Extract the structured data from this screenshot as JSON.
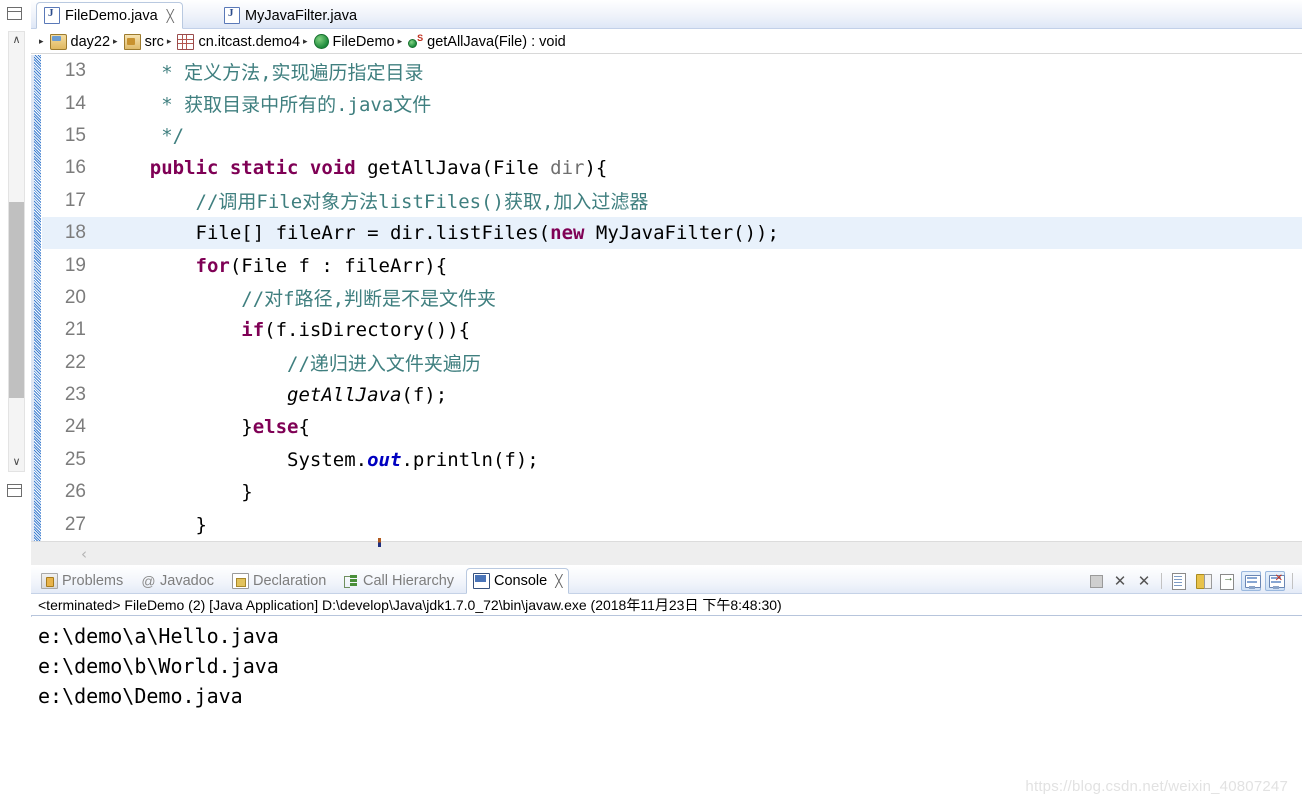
{
  "left_trim": {
    "restore_top_icon": "restore-view-icon",
    "restore_bottom_icon": "restore-view-icon",
    "scroll_up_glyph": "∧",
    "scroll_down_glyph": "∨"
  },
  "editor": {
    "tabs": [
      {
        "label": "FileDemo.java",
        "icon": "java-file-icon",
        "active": true,
        "close": "╳"
      },
      {
        "label": "MyJavaFilter.java",
        "icon": "java-file-icon",
        "active": false,
        "close": ""
      }
    ],
    "breadcrumb": {
      "arrow": "▸",
      "items": [
        {
          "label": "day22",
          "icon": "java-project-icon"
        },
        {
          "label": "src",
          "icon": "source-folder-icon"
        },
        {
          "label": "cn.itcast.demo4",
          "icon": "package-icon"
        },
        {
          "label": "FileDemo",
          "icon": "class-icon"
        },
        {
          "label": "getAllJava(File) : void",
          "icon": "static-method-icon"
        }
      ]
    },
    "hscroll_left_glyph": "‹",
    "lines": [
      {
        "no": "13",
        "highlight": false,
        "segments": [
          {
            "t": "     * ",
            "c": "jdoc"
          },
          {
            "t": "定义方法,实现遍历指定目录",
            "c": "jdoc"
          }
        ]
      },
      {
        "no": "14",
        "highlight": false,
        "segments": [
          {
            "t": "     * ",
            "c": "jdoc"
          },
          {
            "t": "获取目录中所有的.java文件",
            "c": "jdoc"
          }
        ]
      },
      {
        "no": "15",
        "highlight": false,
        "segments": [
          {
            "t": "     */",
            "c": "jdoc"
          }
        ]
      },
      {
        "no": "16",
        "highlight": false,
        "segments": [
          {
            "t": "    ",
            "c": "plain"
          },
          {
            "t": "public static void",
            "c": "kw"
          },
          {
            "t": " getAllJava(File ",
            "c": "plain"
          },
          {
            "t": "dir",
            "c": "param"
          },
          {
            "t": "){",
            "c": "plain"
          }
        ]
      },
      {
        "no": "17",
        "highlight": false,
        "segments": [
          {
            "t": "        ",
            "c": "plain"
          },
          {
            "t": "//调用File对象方法listFiles()获取,加入过滤器",
            "c": "cmt"
          }
        ]
      },
      {
        "no": "18",
        "highlight": true,
        "segments": [
          {
            "t": "        File[] fileArr = dir.listFiles(",
            "c": "plain"
          },
          {
            "t": "new",
            "c": "kw"
          },
          {
            "t": " MyJavaFilter());",
            "c": "plain"
          }
        ]
      },
      {
        "no": "19",
        "highlight": false,
        "segments": [
          {
            "t": "        ",
            "c": "plain"
          },
          {
            "t": "for",
            "c": "kw"
          },
          {
            "t": "(File f : fileArr){",
            "c": "plain"
          }
        ]
      },
      {
        "no": "20",
        "highlight": false,
        "segments": [
          {
            "t": "            ",
            "c": "plain"
          },
          {
            "t": "//对f路径,判断是不是文件夹",
            "c": "cmt"
          }
        ]
      },
      {
        "no": "21",
        "highlight": false,
        "segments": [
          {
            "t": "            ",
            "c": "plain"
          },
          {
            "t": "if",
            "c": "kw"
          },
          {
            "t": "(f.isDirectory()){",
            "c": "plain"
          }
        ]
      },
      {
        "no": "22",
        "highlight": false,
        "segments": [
          {
            "t": "                ",
            "c": "plain"
          },
          {
            "t": "//递归进入文件夹遍历",
            "c": "cmt"
          }
        ]
      },
      {
        "no": "23",
        "highlight": false,
        "segments": [
          {
            "t": "                ",
            "c": "plain"
          },
          {
            "t": "getAllJava",
            "c": "mth"
          },
          {
            "t": "(f);",
            "c": "plain"
          }
        ]
      },
      {
        "no": "24",
        "highlight": false,
        "segments": [
          {
            "t": "            }",
            "c": "plain"
          },
          {
            "t": "else",
            "c": "kw"
          },
          {
            "t": "{",
            "c": "plain"
          }
        ]
      },
      {
        "no": "25",
        "highlight": false,
        "segments": [
          {
            "t": "                System.",
            "c": "plain"
          },
          {
            "t": "out",
            "c": "static"
          },
          {
            "t": ".println(f);",
            "c": "plain"
          }
        ]
      },
      {
        "no": "26",
        "highlight": false,
        "segments": [
          {
            "t": "            }",
            "c": "plain"
          }
        ]
      },
      {
        "no": "27",
        "highlight": false,
        "segments": [
          {
            "t": "        }",
            "c": "plain"
          }
        ]
      }
    ]
  },
  "bottom": {
    "tabs": [
      {
        "label": "Problems",
        "icon": "problems-icon",
        "active": false,
        "close": ""
      },
      {
        "label": "Javadoc",
        "icon": "javadoc-icon",
        "active": false,
        "close": ""
      },
      {
        "label": "Declaration",
        "icon": "declaration-icon",
        "active": false,
        "close": ""
      },
      {
        "label": "Call Hierarchy",
        "icon": "call-hierarchy-icon",
        "active": false,
        "close": ""
      },
      {
        "label": "Console",
        "icon": "console-icon",
        "active": true,
        "close": "╳"
      }
    ],
    "toolbar": [
      {
        "name": "terminate-button",
        "icon": "stop-square-icon"
      },
      {
        "name": "remove-launch-button",
        "icon": "x-icon",
        "glyph": "✕"
      },
      {
        "name": "remove-all-terminated-button",
        "icon": "double-x-icon",
        "glyph": "✕"
      },
      {
        "name": "clear-console-button",
        "icon": "clear-page-icon"
      },
      {
        "name": "scroll-lock-button",
        "icon": "lock-icon"
      },
      {
        "name": "pin-console-button",
        "icon": "pin-page-icon"
      },
      {
        "name": "display-selected-console-button",
        "icon": "console-monitor-icon"
      },
      {
        "name": "open-console-button",
        "icon": "console-monitor-new-icon"
      }
    ],
    "process_desc": "<terminated> FileDemo (2) [Java Application] D:\\develop\\Java\\jdk1.7.0_72\\bin\\javaw.exe (2018年11月23日 下午8:48:30)",
    "output_lines": [
      "e:\\demo\\a\\Hello.java",
      "e:\\demo\\b\\World.java",
      "e:\\demo\\Demo.java"
    ]
  },
  "watermark": "https://blog.csdn.net/weixin_40807247",
  "colors": {
    "keyword": "#7f0055",
    "comment": "#3f7f7f",
    "static_field": "#0000c0",
    "highlight_line": "#e8f1fb",
    "tab_active_border": "#b9c9e0"
  }
}
